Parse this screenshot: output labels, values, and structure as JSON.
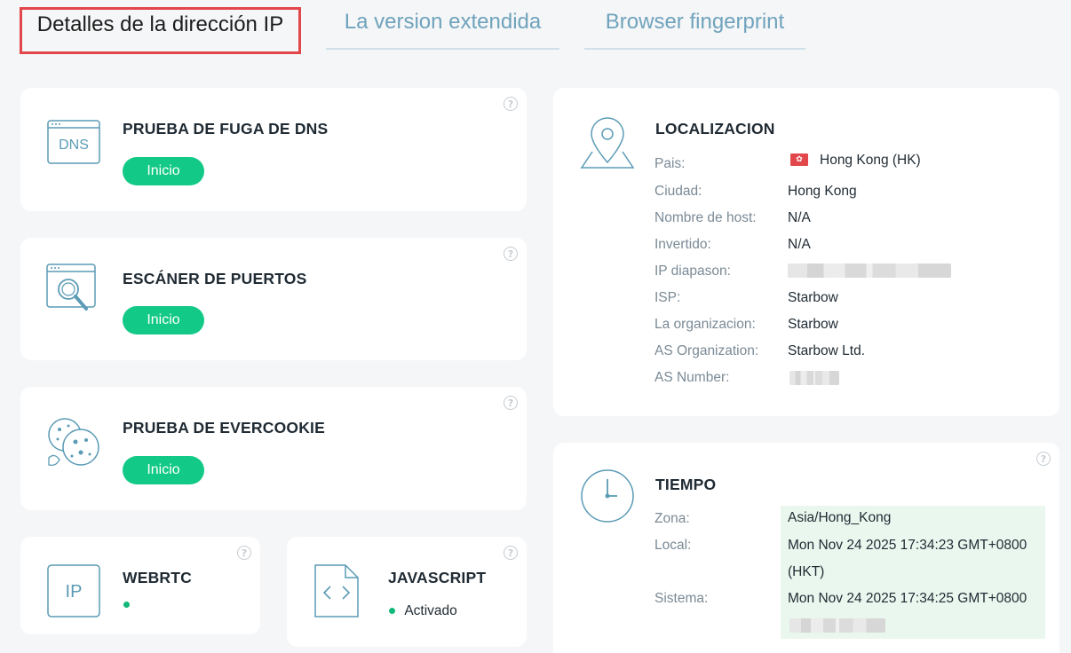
{
  "tabs": [
    {
      "label": "Detalles de la dirección IP"
    },
    {
      "label": "La version extendida"
    },
    {
      "label": "Browser fingerprint"
    }
  ],
  "tests": {
    "dns": {
      "title": "PRUEBA DE FUGA DE DNS",
      "button": "Inicio",
      "icon_text": "DNS"
    },
    "ports": {
      "title": "ESCÁNER DE PUERTOS",
      "button": "Inicio"
    },
    "evercookie": {
      "title": "PRUEBA DE EVERCOOKIE",
      "button": "Inicio"
    },
    "webrtc": {
      "title": "WEBRTC",
      "icon_text": "IP"
    },
    "javascript": {
      "title": "JAVASCRIPT",
      "status": "Activado"
    }
  },
  "help_glyph": "?",
  "location": {
    "title": "LOCALIZACION",
    "rows": [
      {
        "label": "Pais:",
        "value": "Hong Kong (HK)"
      },
      {
        "label": "Ciudad:",
        "value": "Hong Kong"
      },
      {
        "label": "Nombre de host:",
        "value": "N/A"
      },
      {
        "label": "Invertido:",
        "value": "N/A"
      },
      {
        "label": "IP diapason:",
        "value": ""
      },
      {
        "label": "ISP:",
        "value": "Starbow"
      },
      {
        "label": "La organizacion:",
        "value": "Starbow"
      },
      {
        "label": "AS Organization:",
        "value": "Starbow Ltd."
      },
      {
        "label": "AS Number:",
        "value": ""
      }
    ]
  },
  "time": {
    "title": "TIEMPO",
    "zona_label": "Zona:",
    "zona_value": "Asia/Hong_Kong",
    "local_label": "Local:",
    "local_value_line1": "Mon Nov 24 2025 17:34:23 GMT+0800",
    "local_value_line2": "(HKT)",
    "sistema_label": "Sistema:",
    "sistema_value": "Mon Nov 24 2025 17:34:25 GMT+0800"
  },
  "colors": {
    "accent_green": "#12c987",
    "active_tab_border": "#e2474b",
    "tab_text": "#6fa3bd",
    "icon_stroke": "#5b9bb5"
  }
}
